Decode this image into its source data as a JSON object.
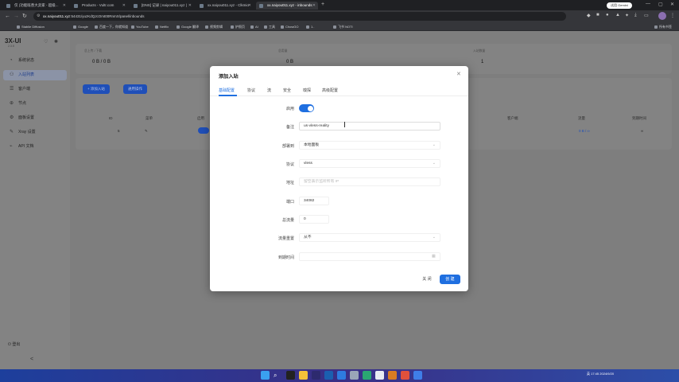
{
  "browser": {
    "tabs": [
      {
        "label": "仅 (功能既善大卖家 - 超级..."
      },
      {
        "label": "Products - Vultr.com"
      },
      {
        "label": "[DNS] 记录 | naiyou011.xyz |"
      },
      {
        "label": "xx.naiyou011.xyz - Clkmio"
      },
      {
        "label": "xx.naiyou011.xyz - inbounds"
      }
    ],
    "new_tab": "+",
    "gemini_label": "试用 Gemini",
    "address": {
      "host": "xx.naiyou011.xyz",
      "path": ":54431/yuzKdQJcOmt00RnmX/panel/inbounds"
    },
    "bookmarks": [
      {
        "label": "Stablie Diffusion"
      },
      {
        "label": "Google"
      },
      {
        "label": "百度一下，你就知道"
      },
      {
        "label": "YouTube"
      },
      {
        "label": "Netflix"
      },
      {
        "label": "Google 翻译"
      },
      {
        "label": "视频剪辑"
      },
      {
        "label": "护照页"
      },
      {
        "label": "AI"
      },
      {
        "label": "工具"
      },
      {
        "label": "ChowGO"
      },
      {
        "label": "1.."
      },
      {
        "label": "飞书 NOTI"
      }
    ],
    "all_bookmarks": "所有书签"
  },
  "sidebar": {
    "logo": "3X-UI",
    "version": "2.3.5",
    "items": [
      {
        "label": "系统状态"
      },
      {
        "label": "入站列表"
      },
      {
        "label": "客户端"
      },
      {
        "label": "节点"
      },
      {
        "label": "面板设置"
      },
      {
        "label": "Xray 设置"
      },
      {
        "label": "API 文档"
      }
    ],
    "logout": "登出",
    "collapse": "<"
  },
  "main": {
    "stats": [
      {
        "label": "总上传 / 下载",
        "value": "0 B / 0 B"
      },
      {
        "label": "总用量",
        "value": "0 B"
      },
      {
        "label": "入站数量",
        "value": "1"
      }
    ],
    "add_button": "+ 添加入站",
    "general_button": "通用操作",
    "columns": [
      "ID",
      "菜单",
      "启用",
      "客户端",
      "流量",
      "到期时间"
    ],
    "row": {
      "id": "5",
      "traffic": "0 B / ∞",
      "expiry": "∞"
    }
  },
  "modal": {
    "title": "添加入站",
    "tabs": [
      "基础配置",
      "协议",
      "流",
      "安全",
      "嗅探",
      "高级配置"
    ],
    "fields": {
      "enable_label": "启用",
      "remark_label": "备注",
      "remark_value": "us-vless-reality",
      "deploy_label": "部署到",
      "deploy_value": "本地面板",
      "protocol_label": "协议",
      "protocol_value": "vless",
      "address_label": "地址",
      "address_placeholder": "留空表示监听所有 IP",
      "port_label": "端口",
      "port_value": "34082",
      "total_label": "总流量",
      "total_value": "0",
      "reset_label": "流量重置",
      "reset_value": "从不",
      "expiry_label": "到期时间"
    },
    "close_button": "关 闭",
    "create_button": "创 建"
  },
  "taskbar": {
    "time": "17:45",
    "date": "2024/9/20",
    "lang": "英"
  },
  "colors": {
    "accent": "#1f6fe0",
    "overlay": "#7e7e7e"
  }
}
